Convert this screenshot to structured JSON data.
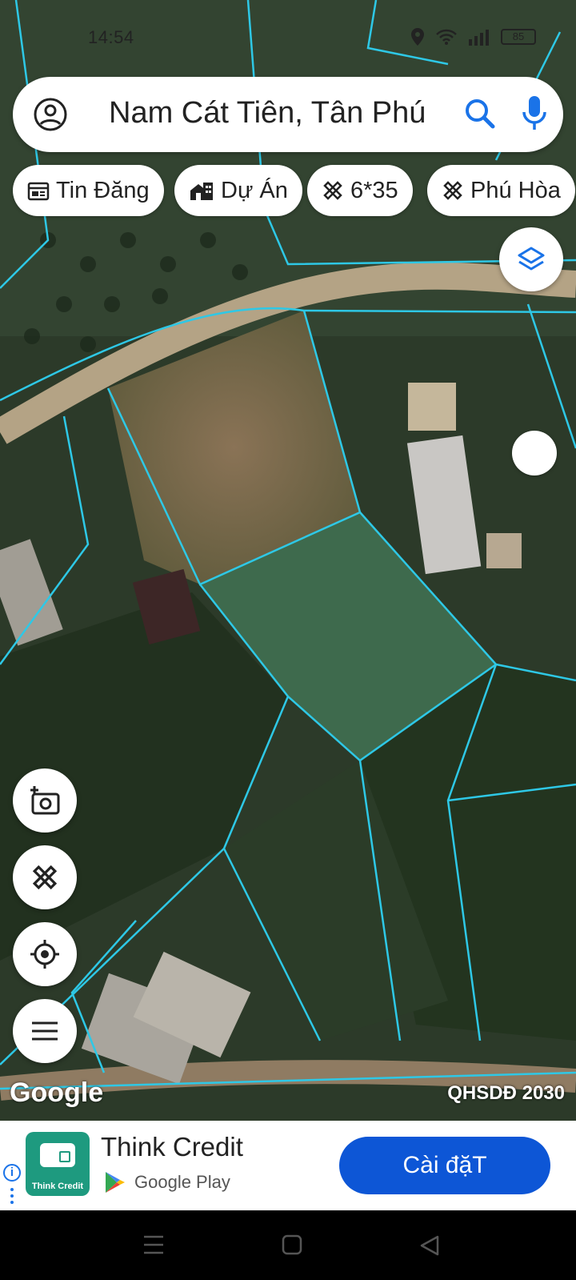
{
  "status_bar": {
    "time": "14:54",
    "battery": "85"
  },
  "search": {
    "query": "Nam Cát Tiên, Tân Phú"
  },
  "chips": [
    {
      "label": "Tin Đăng",
      "icon": "calendar-icon"
    },
    {
      "label": "Dự Án",
      "icon": "buildings-icon"
    },
    {
      "label": "6*35",
      "icon": "ruler-pencil-icon"
    },
    {
      "label": "Phú Hòa",
      "icon": "ruler-pencil-icon"
    }
  ],
  "map": {
    "attribution": "Google",
    "layer_label": "QHSDĐ 2030",
    "parcel_line_color": "#2ec8e6"
  },
  "ad": {
    "app_name": "Think Credit",
    "icon_label": "Think Credit",
    "store": "Google Play",
    "install_label": "Cài đặT",
    "accent": "#0d56d6"
  }
}
